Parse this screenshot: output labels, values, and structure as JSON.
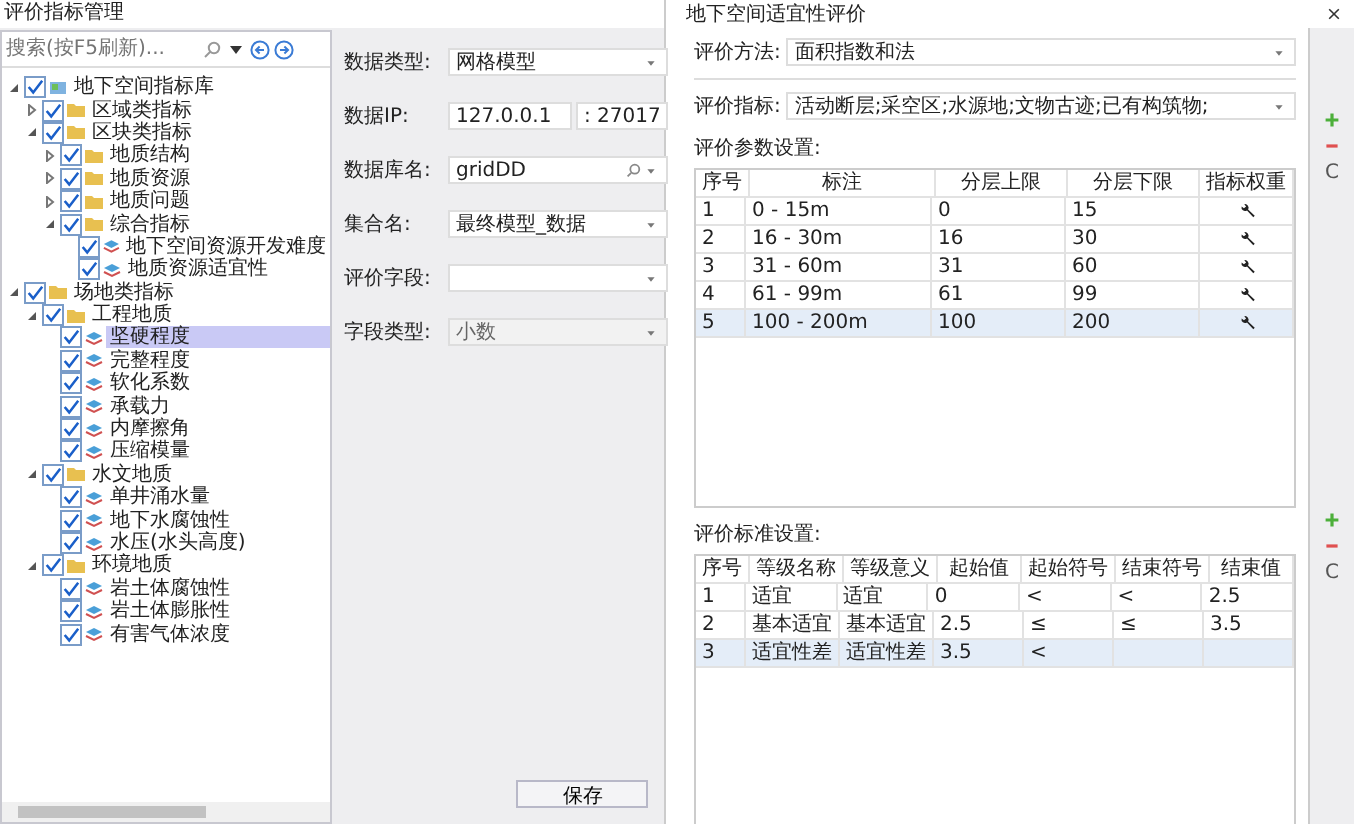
{
  "left_window": {
    "title": "评价指标管理",
    "search": {
      "placeholder": "搜索(按F5刷新)..."
    },
    "tree": [
      {
        "label": "地下空间指标库",
        "kind": "root",
        "checked": true,
        "expanded": true,
        "selected": false,
        "children": [
          {
            "label": "区域类指标",
            "kind": "folder",
            "checked": true,
            "expanded": false,
            "selected": false
          },
          {
            "label": "区块类指标",
            "kind": "folder",
            "checked": true,
            "expanded": true,
            "selected": false,
            "children": [
              {
                "label": "地质结构",
                "kind": "folder",
                "checked": true,
                "expanded": false,
                "selected": false
              },
              {
                "label": "地质资源",
                "kind": "folder",
                "checked": true,
                "expanded": false,
                "selected": false
              },
              {
                "label": "地质问题",
                "kind": "folder",
                "checked": true,
                "expanded": false,
                "selected": false
              },
              {
                "label": "综合指标",
                "kind": "folder",
                "checked": true,
                "expanded": true,
                "selected": false,
                "children": [
                  {
                    "label": "地下空间资源开发难度",
                    "kind": "leaf",
                    "checked": true,
                    "selected": false
                  },
                  {
                    "label": "地质资源适宜性",
                    "kind": "leaf",
                    "checked": true,
                    "selected": false
                  }
                ]
              }
            ]
          }
        ]
      },
      {
        "label": "场地类指标",
        "kind": "folder",
        "checked": true,
        "expanded": true,
        "selected": false,
        "children": [
          {
            "label": "工程地质",
            "kind": "folder",
            "checked": true,
            "expanded": true,
            "selected": false,
            "children": [
              {
                "label": "坚硬程度",
                "kind": "leaf",
                "checked": true,
                "selected": true
              },
              {
                "label": "完整程度",
                "kind": "leaf",
                "checked": true,
                "selected": false
              },
              {
                "label": "软化系数",
                "kind": "leaf",
                "checked": true,
                "selected": false
              },
              {
                "label": "承载力",
                "kind": "leaf",
                "checked": true,
                "selected": false
              },
              {
                "label": "内摩擦角",
                "kind": "leaf",
                "checked": true,
                "selected": false
              },
              {
                "label": "压缩模量",
                "kind": "leaf",
                "checked": true,
                "selected": false
              }
            ]
          },
          {
            "label": "水文地质",
            "kind": "folder",
            "checked": true,
            "expanded": true,
            "selected": false,
            "children": [
              {
                "label": "单井涌水量",
                "kind": "leaf",
                "checked": true,
                "selected": false
              },
              {
                "label": "地下水腐蚀性",
                "kind": "leaf",
                "checked": true,
                "selected": false
              },
              {
                "label": "水压(水头高度)",
                "kind": "leaf",
                "checked": true,
                "selected": false
              }
            ]
          },
          {
            "label": "环境地质",
            "kind": "folder",
            "checked": true,
            "expanded": true,
            "selected": false,
            "children": [
              {
                "label": "岩土体腐蚀性",
                "kind": "leaf",
                "checked": true,
                "selected": false
              },
              {
                "label": "岩土体膨胀性",
                "kind": "leaf",
                "checked": true,
                "selected": false
              },
              {
                "label": "有害气体浓度",
                "kind": "leaf",
                "checked": true,
                "selected": false
              }
            ]
          }
        ]
      }
    ],
    "form": [
      {
        "label": "数据类型:",
        "kind": "select",
        "value": "网格模型",
        "disabled": false
      },
      {
        "label": "数据IP:",
        "kind": "ip",
        "value": "127.0.0.1",
        "port": ": 27017"
      },
      {
        "label": "数据库名:",
        "kind": "search-select",
        "value": "gridDD",
        "disabled": false
      },
      {
        "label": "集合名:",
        "kind": "select",
        "value": "最终模型_数据",
        "disabled": false
      },
      {
        "label": "评价字段:",
        "kind": "select",
        "disabled": false
      },
      {
        "label": "字段类型:",
        "kind": "select",
        "value": "小数",
        "disabled": true
      }
    ],
    "save_button": "保存"
  },
  "right_window": {
    "title": "地下空间适宜性评价",
    "method": {
      "label": "评价方法:",
      "value": "面积指数和法"
    },
    "indicators": {
      "label": "评价指标:",
      "value": "活动断层;采空区;水源地;文物古迹;已有构筑物;"
    },
    "params": {
      "label": "评价参数设置:",
      "columns": [
        "序号",
        "标注",
        "分层上限",
        "分层下限",
        "指标权重"
      ],
      "rows": [
        {
          "cells": [
            "1",
            "0 - 15m",
            "0",
            "15"
          ],
          "selected": false
        },
        {
          "cells": [
            "2",
            "16 - 30m",
            "16",
            "30"
          ],
          "selected": false
        },
        {
          "cells": [
            "3",
            "31 - 60m",
            "31",
            "60"
          ],
          "selected": false
        },
        {
          "cells": [
            "4",
            "61 - 99m",
            "61",
            "99"
          ],
          "selected": false
        },
        {
          "cells": [
            "5",
            "100 - 200m",
            "100",
            "200"
          ],
          "selected": true
        }
      ]
    },
    "standards": {
      "label": "评价标准设置:",
      "columns": [
        "序号",
        "等级名称",
        "等级意义",
        "起始值",
        "起始符号",
        "结束符号",
        "结束值"
      ],
      "rows": [
        {
          "cells": [
            "1",
            "适宜",
            "适宜",
            "0",
            "<",
            "<",
            "2.5"
          ],
          "selected": false
        },
        {
          "cells": [
            "2",
            "基本适宜",
            "基本适宜",
            "2.5",
            "≤",
            "≤",
            "3.5"
          ],
          "selected": false
        },
        {
          "cells": [
            "3",
            "适宜性差",
            "适宜性差",
            "3.5",
            "<",
            "",
            ""
          ],
          "selected": true
        }
      ]
    },
    "params_clear_glyph": "C",
    "standards_clear_glyph": "C"
  }
}
